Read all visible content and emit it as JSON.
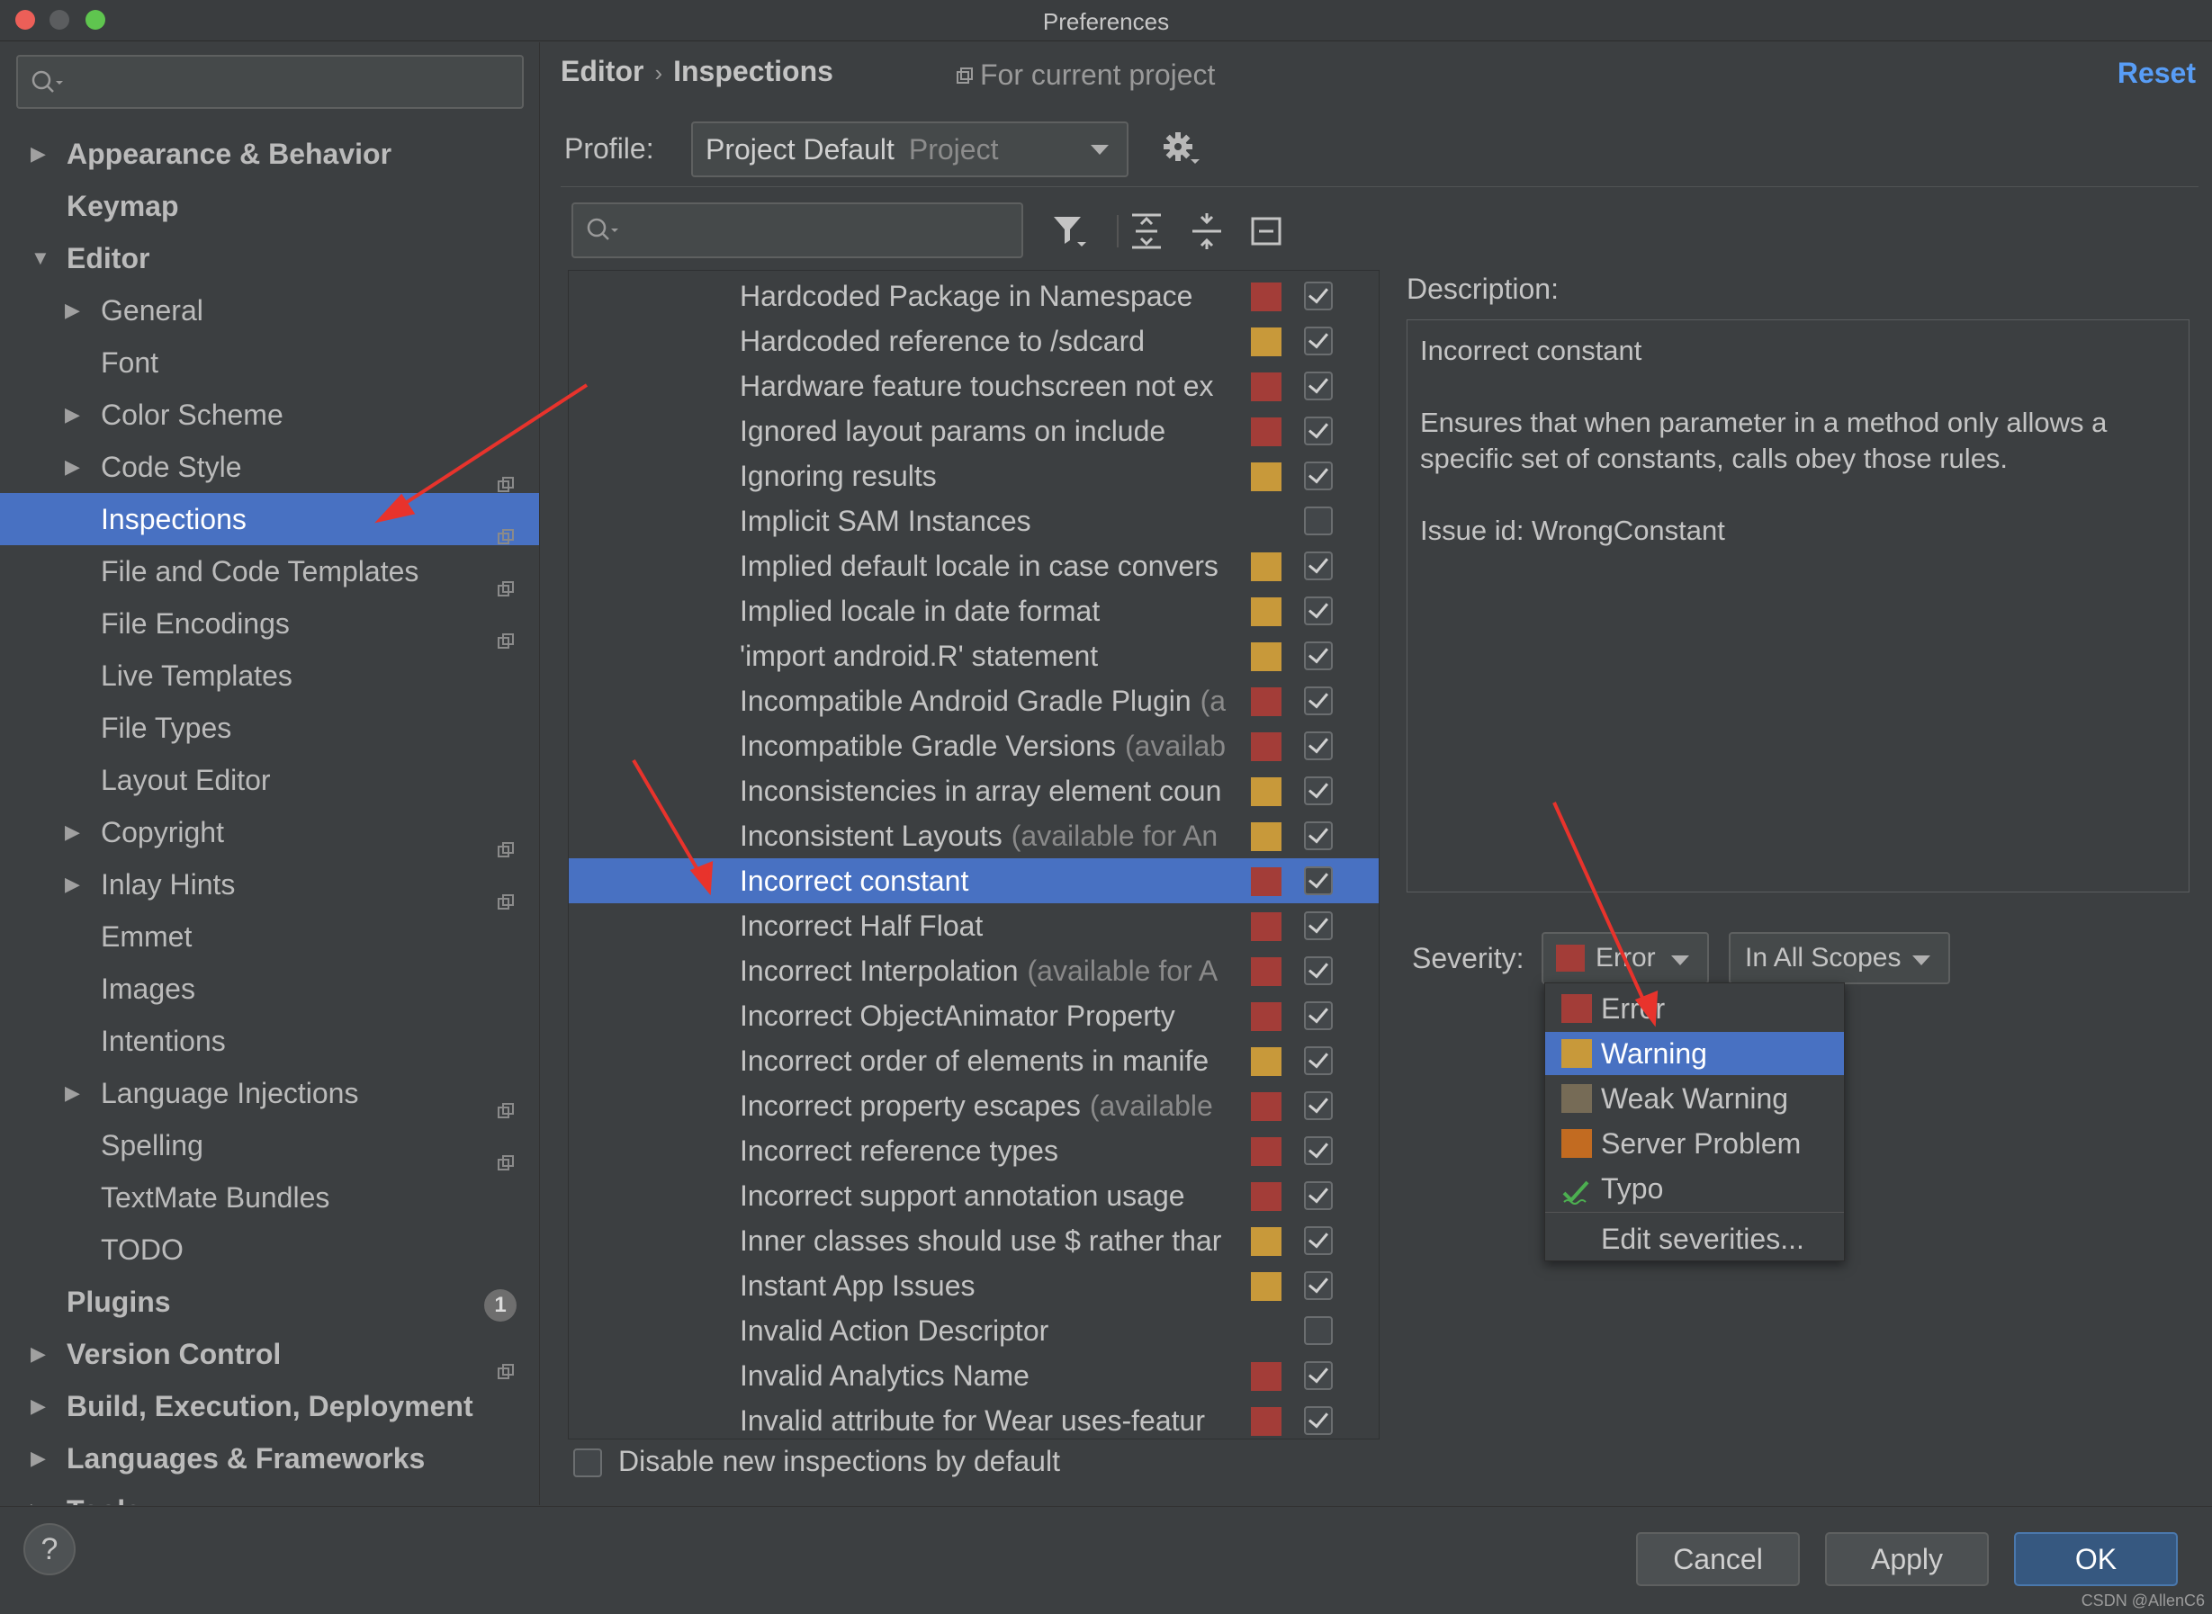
{
  "window": {
    "title": "Preferences"
  },
  "sidebar": {
    "items": [
      {
        "label": "Appearance & Behavior",
        "level": 0,
        "arrow": "collapsed",
        "bold": true
      },
      {
        "label": "Keymap",
        "level": 0,
        "arrow": "none",
        "bold": true
      },
      {
        "label": "Editor",
        "level": 0,
        "arrow": "expanded",
        "bold": true
      },
      {
        "label": "General",
        "level": 1,
        "arrow": "collapsed"
      },
      {
        "label": "Font",
        "level": 1,
        "arrow": "none"
      },
      {
        "label": "Color Scheme",
        "level": 1,
        "arrow": "collapsed"
      },
      {
        "label": "Code Style",
        "level": 1,
        "arrow": "collapsed",
        "project": true
      },
      {
        "label": "Inspections",
        "level": 1,
        "arrow": "none",
        "project": true,
        "selected": true
      },
      {
        "label": "File and Code Templates",
        "level": 1,
        "arrow": "none",
        "project": true
      },
      {
        "label": "File Encodings",
        "level": 1,
        "arrow": "none",
        "project": true
      },
      {
        "label": "Live Templates",
        "level": 1,
        "arrow": "none"
      },
      {
        "label": "File Types",
        "level": 1,
        "arrow": "none"
      },
      {
        "label": "Layout Editor",
        "level": 1,
        "arrow": "none"
      },
      {
        "label": "Copyright",
        "level": 1,
        "arrow": "collapsed",
        "project": true
      },
      {
        "label": "Inlay Hints",
        "level": 1,
        "arrow": "collapsed",
        "project": true
      },
      {
        "label": "Emmet",
        "level": 1,
        "arrow": "none"
      },
      {
        "label": "Images",
        "level": 1,
        "arrow": "none"
      },
      {
        "label": "Intentions",
        "level": 1,
        "arrow": "none"
      },
      {
        "label": "Language Injections",
        "level": 1,
        "arrow": "collapsed",
        "project": true
      },
      {
        "label": "Spelling",
        "level": 1,
        "arrow": "none",
        "project": true
      },
      {
        "label": "TextMate Bundles",
        "level": 1,
        "arrow": "none"
      },
      {
        "label": "TODO",
        "level": 1,
        "arrow": "none"
      },
      {
        "label": "Plugins",
        "level": 0,
        "arrow": "none",
        "bold": true,
        "badge": "1"
      },
      {
        "label": "Version Control",
        "level": 0,
        "arrow": "collapsed",
        "bold": true,
        "project": true
      },
      {
        "label": "Build, Execution, Deployment",
        "level": 0,
        "arrow": "collapsed",
        "bold": true
      },
      {
        "label": "Languages & Frameworks",
        "level": 0,
        "arrow": "collapsed",
        "bold": true
      },
      {
        "label": "Tools",
        "level": 0,
        "arrow": "collapsed",
        "bold": true
      }
    ]
  },
  "header": {
    "breadcrumb_parent": "Editor",
    "breadcrumb_sep": "›",
    "breadcrumb_current": "Inspections",
    "scope_note": "For current project",
    "reset_label": "Reset"
  },
  "profile": {
    "label": "Profile:",
    "name": "Project Default",
    "kind": "Project"
  },
  "inspections": [
    {
      "name": "Hardcoded Package in Namespace",
      "extra": "",
      "severity": "error",
      "checked": true
    },
    {
      "name": "Hardcoded reference to /sdcard",
      "extra": "",
      "severity": "warning",
      "checked": true
    },
    {
      "name": "Hardware feature touchscreen not ex",
      "extra": "",
      "severity": "error",
      "checked": true
    },
    {
      "name": "Ignored layout params on include",
      "extra": "",
      "severity": "error",
      "checked": true
    },
    {
      "name": "Ignoring results",
      "extra": "",
      "severity": "warning",
      "checked": true
    },
    {
      "name": "Implicit SAM Instances",
      "extra": "",
      "severity": "none",
      "checked": false
    },
    {
      "name": "Implied default locale in case convers",
      "extra": "",
      "severity": "warning",
      "checked": true
    },
    {
      "name": "Implied locale in date format",
      "extra": "",
      "severity": "warning",
      "checked": true
    },
    {
      "name": "'import android.R' statement",
      "extra": "",
      "severity": "warning",
      "checked": true
    },
    {
      "name": "Incompatible Android Gradle Plugin",
      "extra": "(a",
      "severity": "error",
      "checked": true
    },
    {
      "name": "Incompatible Gradle Versions",
      "extra": "(availab",
      "severity": "error",
      "checked": true
    },
    {
      "name": "Inconsistencies in array element coun",
      "extra": "",
      "severity": "warning",
      "checked": true
    },
    {
      "name": "Inconsistent Layouts",
      "extra": "(available for An",
      "severity": "warning",
      "checked": true
    },
    {
      "name": "Incorrect constant",
      "extra": "",
      "severity": "error",
      "checked": true,
      "selected": true
    },
    {
      "name": "Incorrect Half Float",
      "extra": "",
      "severity": "error",
      "checked": true
    },
    {
      "name": "Incorrect Interpolation",
      "extra": "(available for A",
      "severity": "error",
      "checked": true
    },
    {
      "name": "Incorrect ObjectAnimator Property",
      "extra": "",
      "severity": "error",
      "checked": true
    },
    {
      "name": "Incorrect order of elements in manife",
      "extra": "",
      "severity": "warning",
      "checked": true
    },
    {
      "name": "Incorrect property escapes",
      "extra": "(available",
      "severity": "error",
      "checked": true
    },
    {
      "name": "Incorrect reference types",
      "extra": "",
      "severity": "error",
      "checked": true
    },
    {
      "name": "Incorrect support annotation usage",
      "extra": "",
      "severity": "error",
      "checked": true
    },
    {
      "name": "Inner classes should use $ rather thar",
      "extra": "",
      "severity": "warning",
      "checked": true
    },
    {
      "name": "Instant App Issues",
      "extra": "",
      "severity": "warning",
      "checked": true
    },
    {
      "name": "Invalid Action Descriptor",
      "extra": "",
      "severity": "none",
      "checked": false
    },
    {
      "name": "Invalid Analytics Name",
      "extra": "",
      "severity": "error",
      "checked": true
    },
    {
      "name": "Invalid attribute for Wear uses-featur",
      "extra": "",
      "severity": "error",
      "checked": true
    }
  ],
  "disable_new_label": "Disable new inspections by default",
  "description": {
    "label": "Description:",
    "title": "Incorrect constant",
    "body": "Ensures that when parameter in a method only allows a specific set of constants, calls obey those rules.",
    "issue": "Issue id: WrongConstant"
  },
  "severity": {
    "label": "Severity:",
    "current": "Error",
    "scope": "In All Scopes",
    "options": [
      {
        "label": "Error",
        "color": "#a33d38"
      },
      {
        "label": "Warning",
        "color": "#c8993a",
        "highlighted": true
      },
      {
        "label": "Weak Warning",
        "color": "#766b56"
      },
      {
        "label": "Server Problem",
        "color": "#c26b21"
      },
      {
        "label": "Typo",
        "icon": "typo-check-icon"
      }
    ],
    "edit_label": "Edit severities..."
  },
  "colors": {
    "error": "#a33d38",
    "warning": "#c8993a",
    "selection": "#4871c2",
    "link": "#589df6",
    "annotation": "#e8332c"
  },
  "footer": {
    "help": "?",
    "cancel": "Cancel",
    "apply": "Apply",
    "ok": "OK",
    "watermark": "CSDN @AllenC6"
  }
}
